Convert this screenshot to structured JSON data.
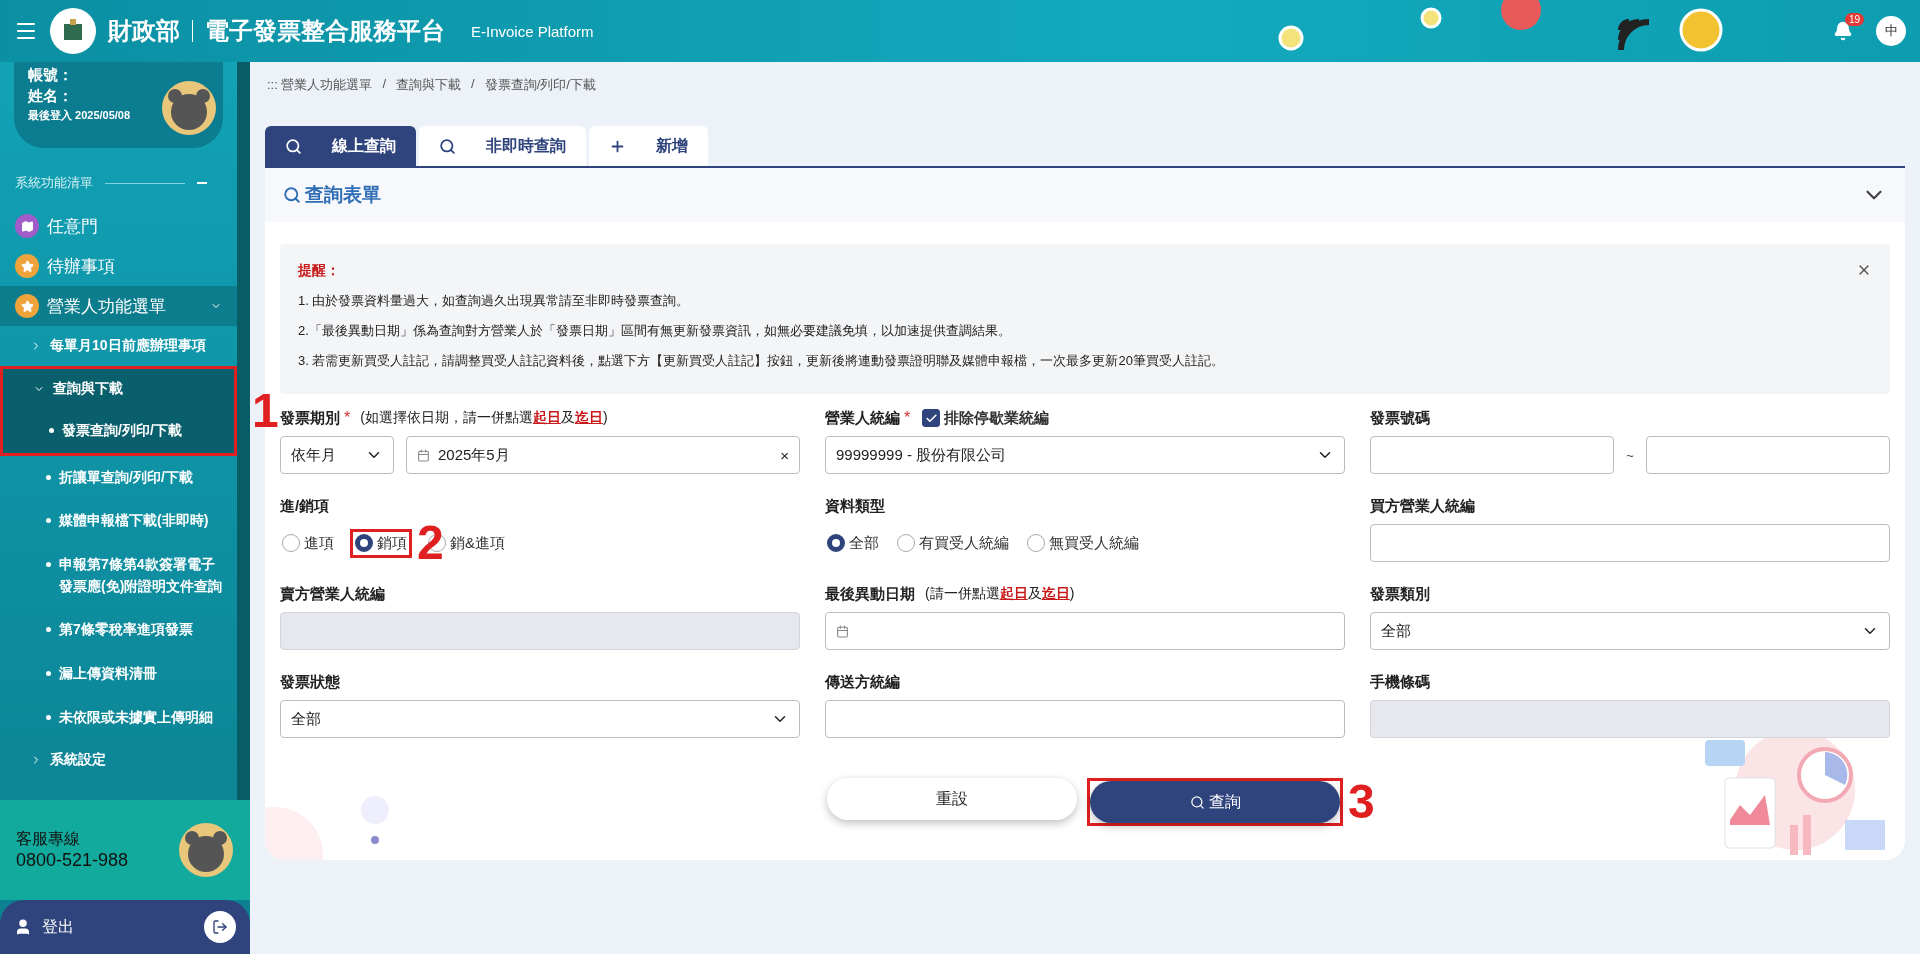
{
  "header": {
    "ministry": "財政部",
    "title": "電子發票整合服務平台",
    "subtitle": "E-Invoice Platform",
    "notification_count": "19",
    "language": "中"
  },
  "user": {
    "account": "帳號：",
    "name": "姓名：",
    "last_login": "最後登入 2025/05/08"
  },
  "menu": {
    "heading": "系統功能清單",
    "items": [
      {
        "kind": "map",
        "label": "任意門",
        "color": "#a05cc9",
        "expanded": false
      },
      {
        "kind": "star",
        "label": "待辦事項",
        "color": "#f0a33a",
        "expanded": false
      },
      {
        "kind": "star",
        "label": "營業人功能選單",
        "color": "#f0a33a",
        "expanded": true,
        "children": [
          {
            "label": "每單月10日前應辦理事項",
            "expanded": false
          },
          {
            "label": "查詢與下載",
            "expanded": true,
            "annotation": "1",
            "children": [
              {
                "label": "發票查詢/列印/下載",
                "selected": true
              },
              {
                "label": "折讓單查詢/列印/下載",
                "selected": false
              },
              {
                "label": "媒體申報檔下載(非即時)",
                "selected": false
              },
              {
                "label": "申報第7條第4款簽署電子發票應(免)附證明文件查詢",
                "selected": false
              },
              {
                "label": "第7條零稅率進項發票",
                "selected": false
              },
              {
                "label": "漏上傳資料清冊",
                "selected": false
              },
              {
                "label": "未依限或未據實上傳明細",
                "selected": false
              }
            ]
          },
          {
            "label": "系統設定",
            "expanded": false
          }
        ]
      }
    ]
  },
  "support": {
    "label": "客服專線",
    "phone": "0800-521-988"
  },
  "logout": "登出",
  "breadcrumb": {
    "separator": "/",
    "items": [
      "::: 營業人功能選單",
      "查詢與下載",
      "發票查詢/列印/下載"
    ]
  },
  "tabs": [
    {
      "kind": "search",
      "label": "線上查詢",
      "selected": true
    },
    {
      "kind": "search",
      "label": "非即時查詢",
      "selected": false
    },
    {
      "kind": "plus",
      "label": "新增",
      "selected": false
    }
  ],
  "panel": {
    "title": "查詢表單",
    "expanded": true
  },
  "notice": {
    "title": "提醒：",
    "lines": [
      "1. 由於發票資料量過大，如查詢過久出現異常請至非即時發票查詢。",
      "2.「最後異動日期」係為查詢對方營業人於「發票日期」區間有無更新發票資訊，如無必要建議免填，以加速提供查調結果。",
      "3. 若需更新買受人註記，請調整買受人註記資料後，點選下方【更新買受人註記】按鈕，更新後將連動發票證明聯及媒體申報檔，一次最多更新20筆買受人註記。"
    ]
  },
  "fields": [
    {
      "kind": "period",
      "label": "發票期別",
      "required_mark": "*",
      "hint": "(如選擇依日期，請一併點選**起日**及**迄日**)",
      "select": "依年月",
      "date": "2025年5月",
      "clear": "×"
    },
    {
      "kind": "select",
      "label": "營業人統編",
      "required_mark": "*",
      "checkbox": {
        "label": "排除停歇業統編",
        "checked": true
      },
      "value": "99999999 - 股份有限公司"
    },
    {
      "kind": "range",
      "label": "發票號碼",
      "separator": "~"
    },
    {
      "kind": "radio",
      "label": "進/銷項",
      "options": [
        {
          "label": "進項",
          "selected": false
        },
        {
          "label": "銷項",
          "selected": true,
          "annotation": "2"
        },
        {
          "label": "銷&進項",
          "selected": false
        }
      ]
    },
    {
      "kind": "radio",
      "label": "資料類型",
      "options": [
        {
          "label": "全部",
          "selected": true
        },
        {
          "label": "有買受人統編",
          "selected": false
        },
        {
          "label": "無買受人統編",
          "selected": false
        }
      ]
    },
    {
      "kind": "text",
      "label": "買方營業人統編",
      "disabled": false
    },
    {
      "kind": "text",
      "label": "賣方營業人統編",
      "disabled": true
    },
    {
      "kind": "date",
      "label": "最後異動日期",
      "hint": "(請一併點選**起日**及**迄日**)"
    },
    {
      "kind": "select",
      "label": "發票類別",
      "value": "全部"
    },
    {
      "kind": "select",
      "label": "發票狀態",
      "value": "全部"
    },
    {
      "kind": "text",
      "label": "傳送方統編",
      "disabled": false
    },
    {
      "kind": "text",
      "label": "手機條碼",
      "disabled": true
    }
  ],
  "buttons": [
    {
      "kind": "secondary",
      "label": "重設"
    },
    {
      "kind": "primary",
      "label": "查詢",
      "annotation": "3"
    }
  ]
}
